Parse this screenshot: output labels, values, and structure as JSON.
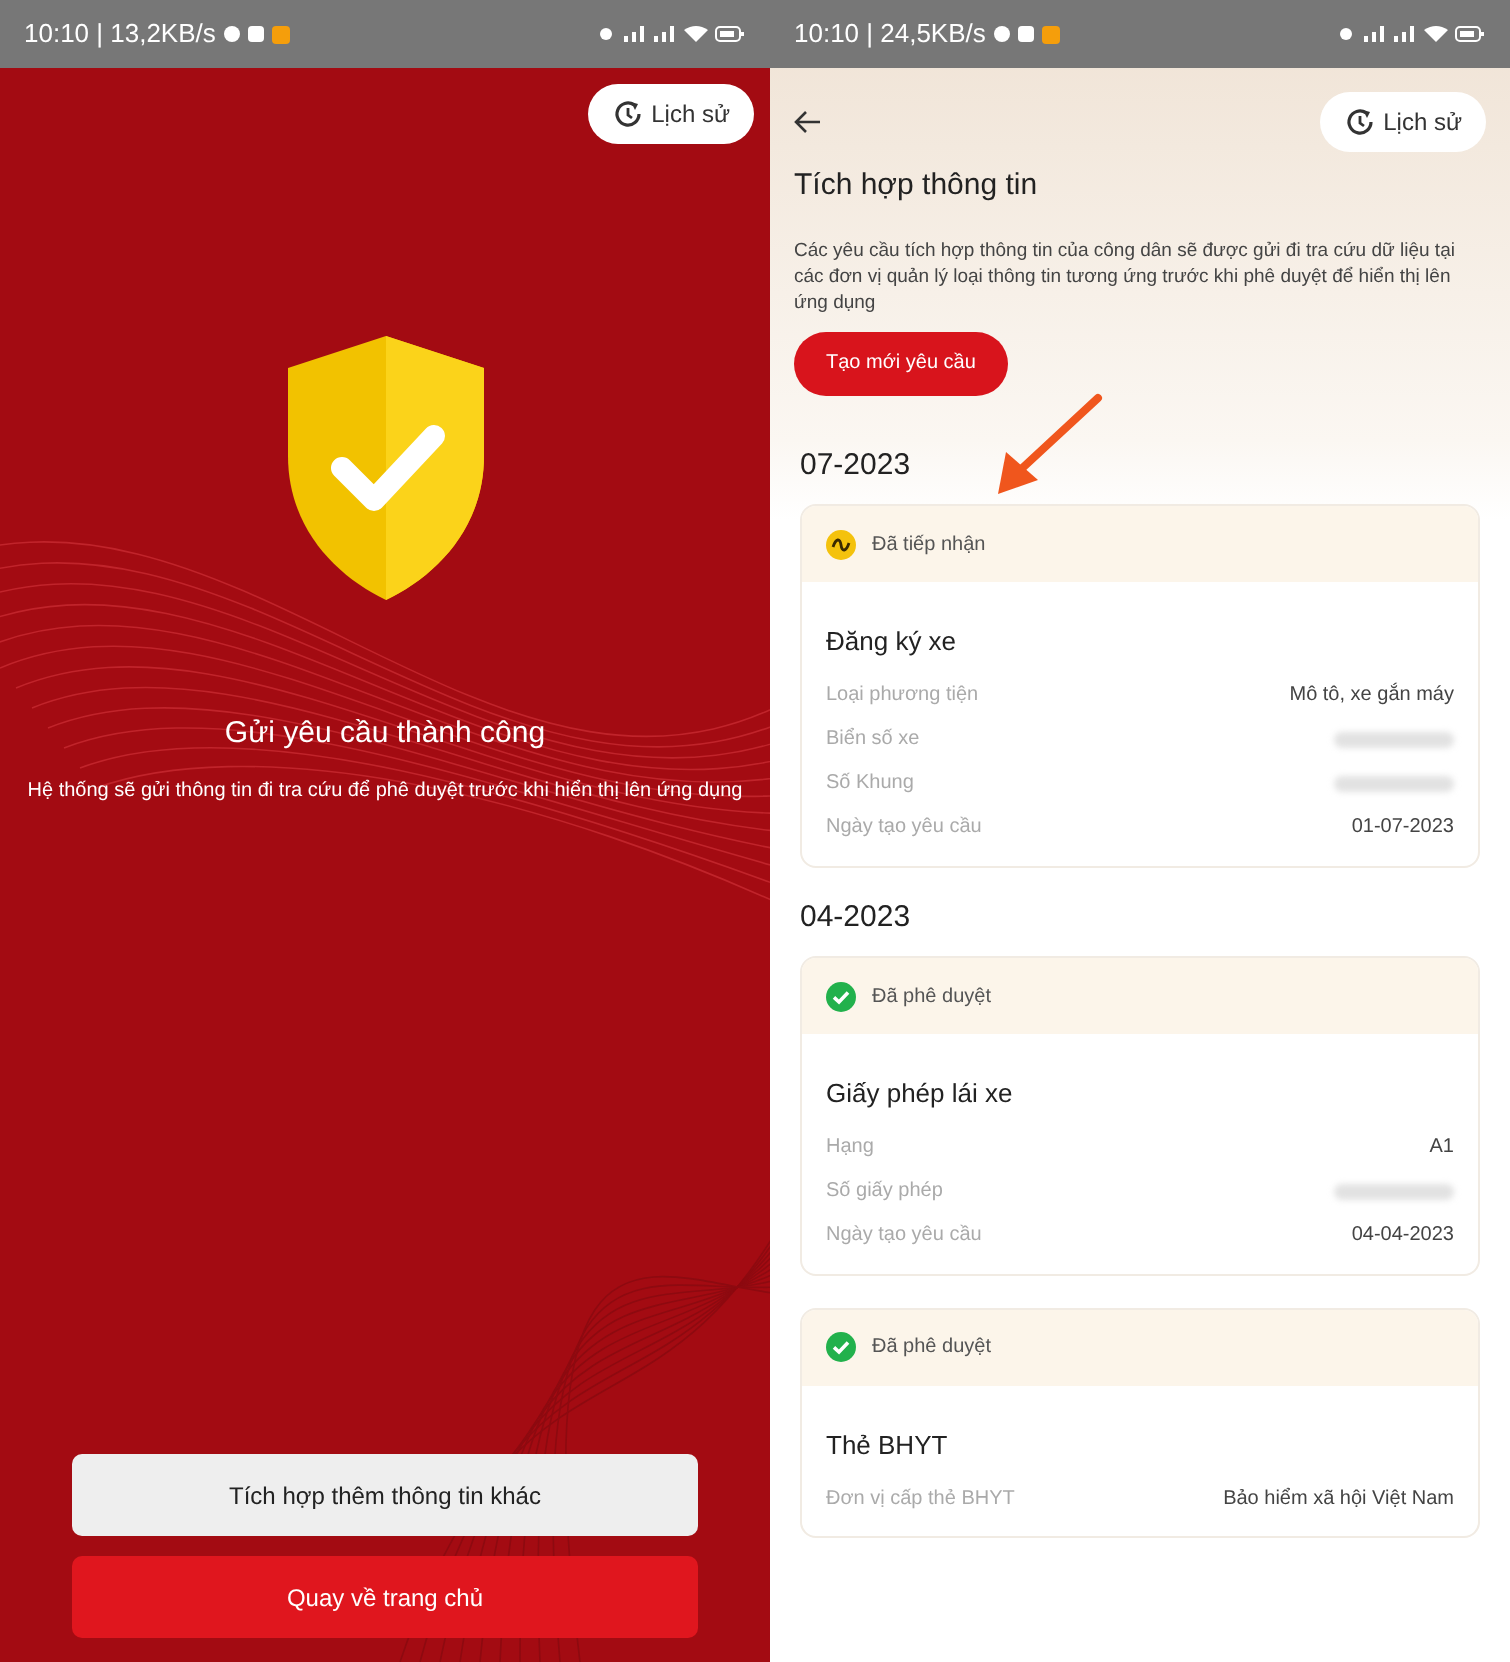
{
  "left_screen": {
    "status_bar": {
      "time": "10:10 | 13,2KB/s"
    },
    "history_button": "Lịch sử",
    "title": "Gửi yêu cầu thành công",
    "message": "Hệ thống sẽ gửi thông tin đi tra cứu để phê duyệt trước khi hiển thị lên ứng dụng",
    "buttons": [
      {
        "label": "Tích hợp thêm thông tin khác",
        "kind": "secondary"
      },
      {
        "label": "Quay về trang chủ",
        "kind": "primary"
      }
    ]
  },
  "right_screen": {
    "status_bar": {
      "time": "10:10 | 24,5KB/s"
    },
    "history_button": "Lịch sử",
    "title": "Tích hợp thông tin",
    "description": "Các yêu cầu tích hợp thông tin của công dân sẽ được gửi đi tra cứu dữ liệu tại các đơn vị quản lý loại thông tin tương ứng trước khi phê duyệt để hiển thị lên ứng dụng",
    "create_button": "Tạo mới yêu cầu",
    "groups": [
      {
        "month": "07-2023",
        "cards": [
          {
            "status": "Đã tiếp nhận",
            "kind": "received",
            "name": "Đăng ký xe",
            "rows": [
              {
                "label": "Loại phương tiện",
                "kind": "text",
                "value": "Mô tô, xe gắn máy"
              },
              {
                "label": "Biển số xe",
                "kind": "hidden"
              },
              {
                "label": "Số Khung",
                "kind": "hidden"
              },
              {
                "label": "Ngày tạo yêu cầu",
                "kind": "text",
                "value": "01-07-2023"
              }
            ]
          }
        ]
      },
      {
        "month": "04-2023",
        "cards": [
          {
            "status": "Đã phê duyệt",
            "kind": "approved",
            "name": "Giấy phép lái xe",
            "rows": [
              {
                "label": "Hạng",
                "kind": "text",
                "value": "A1"
              },
              {
                "label": "Số giấy phép",
                "kind": "hidden"
              },
              {
                "label": "Ngày tạo yêu cầu",
                "kind": "text",
                "value": "04-04-2023"
              }
            ]
          },
          {
            "status": "Đã phê duyệt",
            "kind": "approved",
            "name": "Thẻ BHYT",
            "rows": [
              {
                "label": "Đơn vị cấp thẻ BHYT",
                "kind": "text",
                "value": "Bảo hiểm xã hội Việt Nam"
              }
            ]
          }
        ]
      }
    ]
  }
}
